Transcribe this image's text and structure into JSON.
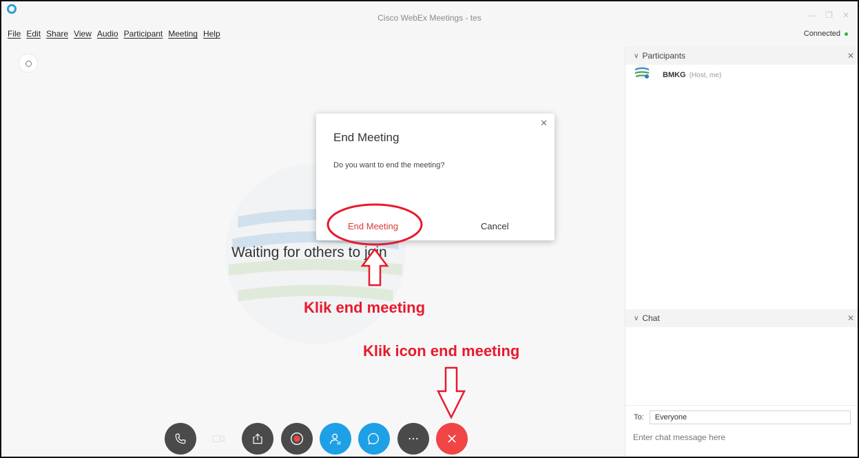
{
  "window": {
    "title": "Cisco WebEx Meetings - tes",
    "status": "Connected"
  },
  "menu": {
    "items": [
      "File",
      "Edit",
      "Share",
      "View",
      "Audio",
      "Participant",
      "Meeting",
      "Help"
    ]
  },
  "stage": {
    "waiting_text": "Waiting for others to join"
  },
  "dialog": {
    "title": "End Meeting",
    "message": "Do you want to end the meeting?",
    "end_label": "End Meeting",
    "cancel_label": "Cancel"
  },
  "annotations": {
    "label_dialog": "Klik end meeting",
    "label_icon": "Klik icon end meeting",
    "color": "#e8192c"
  },
  "controls": [
    {
      "name": "audio-button",
      "icon": "phone-icon",
      "color": "#4a4a4a"
    },
    {
      "name": "video-button",
      "icon": "video-icon",
      "color": "#e8e8e8"
    },
    {
      "name": "share-button",
      "icon": "share-icon",
      "color": "#4a4a4a"
    },
    {
      "name": "record-button",
      "icon": "record-icon",
      "color": "#4a4a4a"
    },
    {
      "name": "participants-button",
      "icon": "participants-icon",
      "color": "#1ea0e6"
    },
    {
      "name": "chat-button",
      "icon": "chat-icon",
      "color": "#1ea0e6"
    },
    {
      "name": "more-button",
      "icon": "more-icon",
      "color": "#4a4a4a"
    },
    {
      "name": "end-meeting-button",
      "icon": "close-icon",
      "color": "#f04545"
    }
  ],
  "participants_panel": {
    "title": "Participants",
    "participants": [
      {
        "name": "BMKG",
        "role": "(Host, me)"
      }
    ]
  },
  "chat_panel": {
    "title": "Chat",
    "to_label": "To:",
    "to_value": "Everyone",
    "placeholder": "Enter chat message here"
  }
}
